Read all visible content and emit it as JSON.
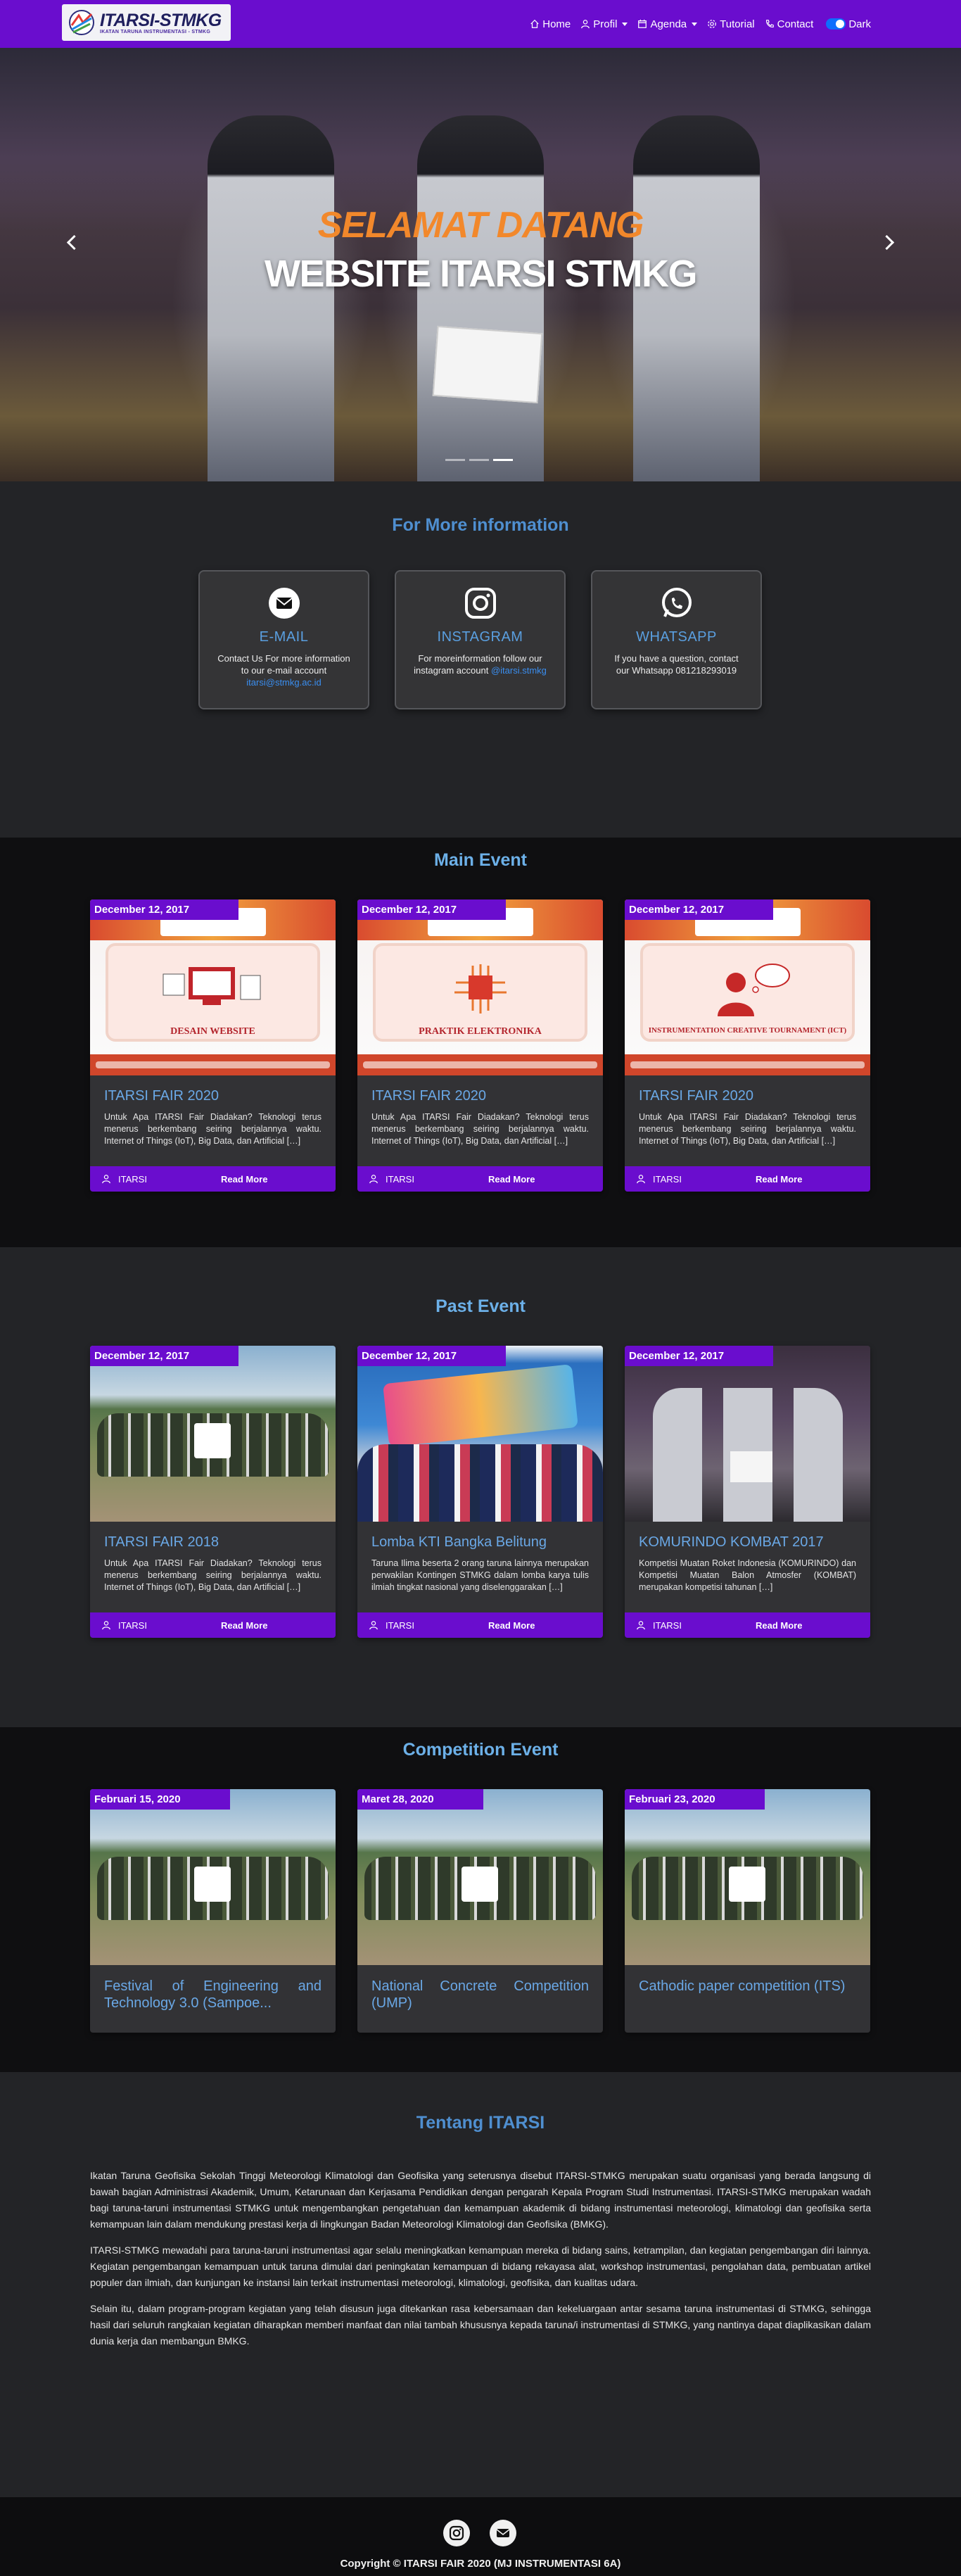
{
  "navbar": {
    "brand_title": "ITARSI-STMKG",
    "brand_subtitle": "IKATAN TARUNA INSTRUMENTASI - STMKG",
    "items": [
      {
        "label": "Home",
        "icon": "home-icon",
        "dropdown": false
      },
      {
        "label": "Profil",
        "icon": "user-icon",
        "dropdown": true
      },
      {
        "label": "Agenda",
        "icon": "calendar-icon",
        "dropdown": true
      },
      {
        "label": "Tutorial",
        "icon": "gear-icon",
        "dropdown": false
      },
      {
        "label": "Contact",
        "icon": "phone-icon",
        "dropdown": false
      }
    ],
    "dark_label": "Dark",
    "dark_mode": true
  },
  "hero": {
    "welcome": "SELAMAT DATANG",
    "title": "WEBSITE ITARSI STMKG",
    "slides": 3,
    "active_slide": 2
  },
  "info": {
    "title": "For More information",
    "cards": [
      {
        "icon": "email-icon",
        "title": "E-MAIL",
        "text": "Contact Us For more information to our e-mail account ",
        "link": "itarsi@stmkg.ac.id",
        "after": ""
      },
      {
        "icon": "instagram-icon",
        "title": "INSTAGRAM",
        "text": "For moreinformation follow our instagram account ",
        "link": "@itarsi.stmkg",
        "after": ""
      },
      {
        "icon": "whatsapp-icon",
        "title": "WHATSAPP",
        "text": "If you have a question, contact our Whatsapp ",
        "link": "",
        "after": "081218293019"
      }
    ]
  },
  "main_event": {
    "title": "Main Event",
    "cards": [
      {
        "date": "December 12, 2017",
        "poster": "DESAIN WEBSITE",
        "title": "ITARSI FAIR 2020",
        "desc": "Untuk Apa ITARSI Fair Diadakan? Teknologi terus menerus berkembang seiring berjalannya waktu. Internet of Things (IoT), Big Data, dan Artificial […]",
        "author": "ITARSI",
        "read": "Read More"
      },
      {
        "date": "December 12, 2017",
        "poster": "PRAKTIK ELEKTRONIKA",
        "title": "ITARSI FAIR 2020",
        "desc": "Untuk Apa ITARSI Fair Diadakan? Teknologi terus menerus berkembang seiring berjalannya waktu. Internet of Things (IoT), Big Data, dan Artificial […]",
        "author": "ITARSI",
        "read": "Read More"
      },
      {
        "date": "December 12, 2017",
        "poster": "INSTRUMENTATION CREATIVE TOURNAMENT (ICT)",
        "title": "ITARSI FAIR 2020",
        "desc": "Untuk Apa ITARSI Fair Diadakan? Teknologi terus menerus berkembang seiring berjalannya waktu. Internet of Things (IoT), Big Data, dan Artificial […]",
        "author": "ITARSI",
        "read": "Read More"
      }
    ]
  },
  "past_event": {
    "title": "Past Event",
    "cards": [
      {
        "date": "December 12, 2017",
        "title": "ITARSI FAIR 2018",
        "desc": "Untuk Apa ITARSI Fair Diadakan? Teknologi terus menerus berkembang seiring berjalannya waktu. Internet of Things (IoT), Big Data, dan Artificial […]",
        "author": "ITARSI",
        "read": "Read More"
      },
      {
        "date": "December 12, 2017",
        "title": "Lomba KTI Bangka Belitung",
        "desc": "Taruna Ilima beserta 2 orang taruna lainnya merupakan perwakilan Kontingen STMKG dalam lomba karya tulis ilmiah tingkat nasional yang diselenggarakan […]",
        "author": "ITARSI",
        "read": "Read More"
      },
      {
        "date": "December 12, 2017",
        "title": "KOMURINDO KOMBAT 2017",
        "desc": "Kompetisi Muatan Roket Indonesia (KOMURINDO) dan Kompetisi Muatan Balon Atmosfer (KOMBAT) merupakan kompetisi tahunan […]",
        "author": "ITARSI",
        "read": "Read More"
      }
    ]
  },
  "competition_event": {
    "title": "Competition Event",
    "cards": [
      {
        "date": "Februari 15, 2020",
        "title": "Festival of Engineering and Technology 3.0 (Sampoe..."
      },
      {
        "date": "Maret 28, 2020",
        "title": "National Concrete Competition (UMP)"
      },
      {
        "date": "Februari 23, 2020",
        "title": "Cathodic paper competition (ITS)"
      }
    ]
  },
  "about": {
    "title": "Tentang ITARSI",
    "paragraphs": [
      "Ikatan Taruna Geofisika Sekolah Tinggi Meteorologi Klimatologi dan Geofisika yang seterusnya disebut ITARSI-STMKG merupakan suatu organisasi yang berada langsung di bawah bagian Administrasi Akademik, Umum, Ketarunaan dan Kerjasama Pendidikan dengan pengarah Kepala Program Studi Instrumentasi. ITARSI-STMKG merupakan wadah bagi taruna-taruni instrumentasi STMKG untuk mengembangkan pengetahuan dan kemampuan akademik di bidang instrumentasi meteorologi, klimatologi dan geofisika serta kemampuan lain dalam mendukung prestasi kerja di lingkungan Badan Meteorologi Klimatologi dan Geofisika (BMKG).",
      "ITARSI-STMKG mewadahi para taruna-taruni instrumentasi agar selalu meningkatkan kemampuan mereka di bidang sains, ketrampilan, dan kegiatan pengembangan diri lainnya. Kegiatan pengembangan kemampuan untuk taruna dimulai dari peningkatan kemampuan di bidang rekayasa alat, workshop instrumentasi, pengolahan data, pembuatan artikel populer dan ilmiah, dan kunjungan ke instansi lain terkait instrumentasi meteorologi, klimatologi, geofisika, dan kualitas udara.",
      "Selain itu, dalam program-program kegiatan yang telah disusun juga ditekankan rasa kebersamaan dan kekeluargaan antar sesama taruna instrumentasi di STMKG, sehingga hasil dari seluruh rangkaian kegiatan diharapkan memberi manfaat dan nilai tambah khususnya kepada taruna/i instrumentasi di STMKG, yang nantinya dapat diaplikasikan dalam dunia kerja dan membangun BMKG."
    ]
  },
  "footer": {
    "copyright": "Copyright © ITARSI FAIR 2020 (MJ INSTRUMENTASI 6A)",
    "icons": [
      "instagram-icon",
      "email-icon"
    ]
  },
  "colors": {
    "primary": "#6a0dce",
    "accent": "#f2882b",
    "link": "#3a8ef0",
    "title_blue": "#5a9fe0"
  }
}
